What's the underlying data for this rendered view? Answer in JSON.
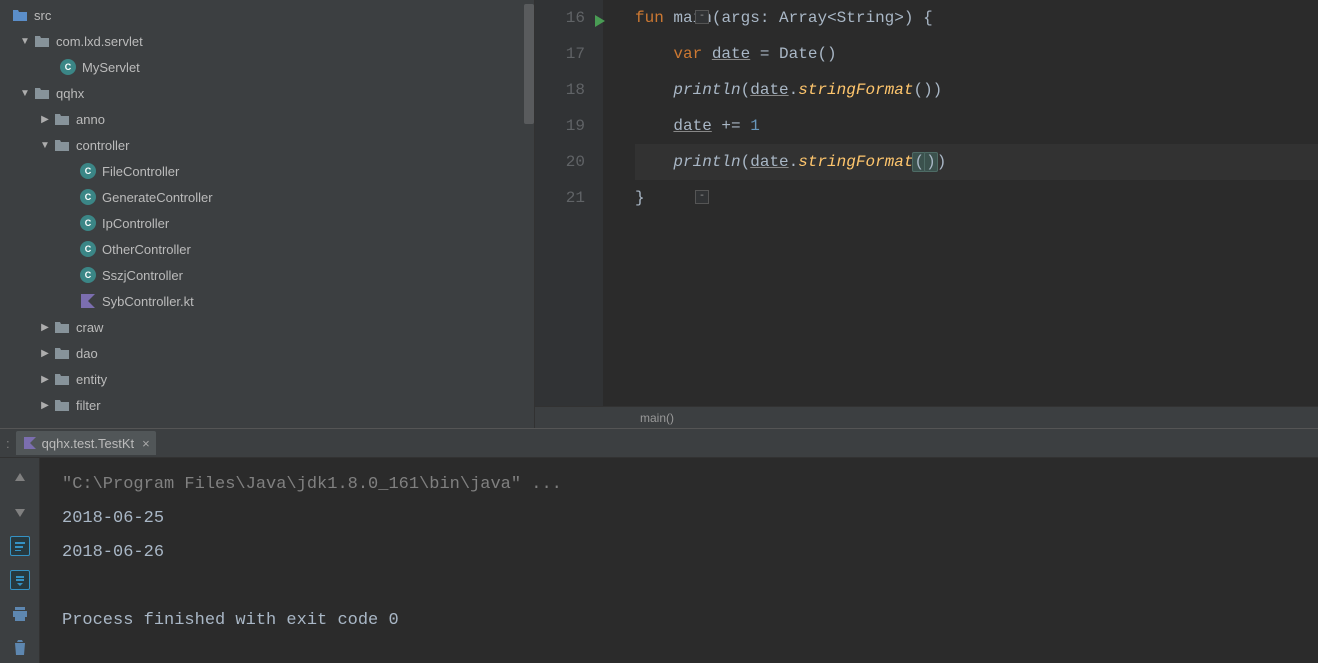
{
  "tree": [
    {
      "indent": 0,
      "chev": "",
      "icon": "src",
      "label": "src"
    },
    {
      "indent": 1,
      "chev": "▼",
      "icon": "folder",
      "label": "com.lxd.servlet"
    },
    {
      "indent": 2,
      "chev": "",
      "icon": "cls",
      "label": "MyServlet"
    },
    {
      "indent": 1,
      "chev": "▼",
      "icon": "folder",
      "label": "qqhx"
    },
    {
      "indent": 2,
      "chev": "▶",
      "icon": "folder",
      "label": "anno"
    },
    {
      "indent": 2,
      "chev": "▼",
      "icon": "folder",
      "label": "controller"
    },
    {
      "indent": 3,
      "chev": "",
      "icon": "cls",
      "label": "FileController"
    },
    {
      "indent": 3,
      "chev": "",
      "icon": "cls",
      "label": "GenerateController"
    },
    {
      "indent": 3,
      "chev": "",
      "icon": "cls",
      "label": "IpController"
    },
    {
      "indent": 3,
      "chev": "",
      "icon": "cls",
      "label": "OtherController"
    },
    {
      "indent": 3,
      "chev": "",
      "icon": "cls",
      "label": "SszjController"
    },
    {
      "indent": 3,
      "chev": "",
      "icon": "kt",
      "label": "SybController.kt"
    },
    {
      "indent": 2,
      "chev": "▶",
      "icon": "folder",
      "label": "craw"
    },
    {
      "indent": 2,
      "chev": "▶",
      "icon": "folder",
      "label": "dao"
    },
    {
      "indent": 2,
      "chev": "▶",
      "icon": "folder",
      "label": "entity"
    },
    {
      "indent": 2,
      "chev": "▶",
      "icon": "folder",
      "label": "filter"
    }
  ],
  "code": {
    "line_start": 16,
    "lines": {
      "l16": {
        "kw1": "fun",
        "id1": "main",
        "id2": "args",
        "id3": "Array",
        "id4": "String"
      },
      "l17": {
        "kw1": "var",
        "id1": "date",
        "id2": "Date"
      },
      "l18": {
        "fn": "println",
        "id1": "date",
        "fn2": "stringFormat"
      },
      "l19": {
        "id1": "date",
        "num": "1"
      },
      "l20": {
        "fn": "println",
        "id1": "date",
        "fn2": "stringFormat"
      }
    }
  },
  "breadcrumb": "main()",
  "run": {
    "tab": "qqhx.test.TestKt",
    "close": "×",
    "cmd": "\"C:\\Program Files\\Java\\jdk1.8.0_161\\bin\\java\" ...",
    "out1": "2018-06-25",
    "out2": "2018-06-26",
    "exit": "Process finished with exit code 0"
  }
}
